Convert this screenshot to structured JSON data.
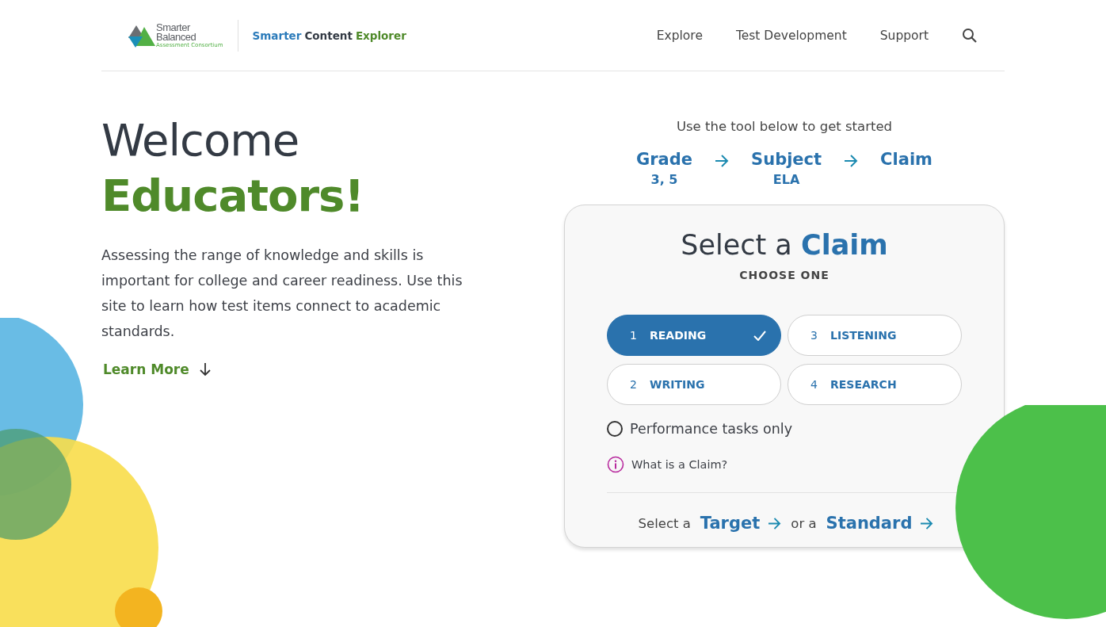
{
  "logo": {
    "line_1": "Smarter",
    "line_2": "Balanced",
    "tagline": "Assessment Consortium"
  },
  "site_title": [
    {
      "text": "Smarter",
      "kind": "blue"
    },
    {
      "text": "Content",
      "kind": "dark"
    },
    {
      "text": "Explorer",
      "kind": "green"
    }
  ],
  "nav": [
    "Explore",
    "Test Development",
    "Support"
  ],
  "hero": {
    "title_light": "Welcome",
    "title_bold": "Educators!",
    "intro": "Assessing the range of knowledge and skills is important for college and career readiness. Use this site to learn how test items connect to academic standards.",
    "link": "Learn More"
  },
  "tool_hint": "Use the tool below to get started",
  "steps": [
    {
      "label": "Grade",
      "value": "3, 5"
    },
    {
      "label": "Subject",
      "value": "ELA"
    },
    {
      "label": "Claim"
    }
  ],
  "card": {
    "title_light": "Select a",
    "title_bold": "Claim",
    "subtitle": "CHOOSE ONE",
    "claims": [
      {
        "number": "1",
        "label": "READING",
        "selected": true
      },
      {
        "number": "3",
        "label": "LISTENING",
        "selected": false
      },
      {
        "number": "2",
        "label": "WRITING",
        "selected": false
      },
      {
        "number": "4",
        "label": "RESEARCH",
        "selected": false
      }
    ],
    "performance_tasks": {
      "label": "Performance tasks only",
      "checked": false
    },
    "help_link": "What is a Claim?",
    "footer": {
      "select_text": "Select a",
      "target": "Target",
      "or_text": "or a",
      "standard": "Standard"
    }
  }
}
